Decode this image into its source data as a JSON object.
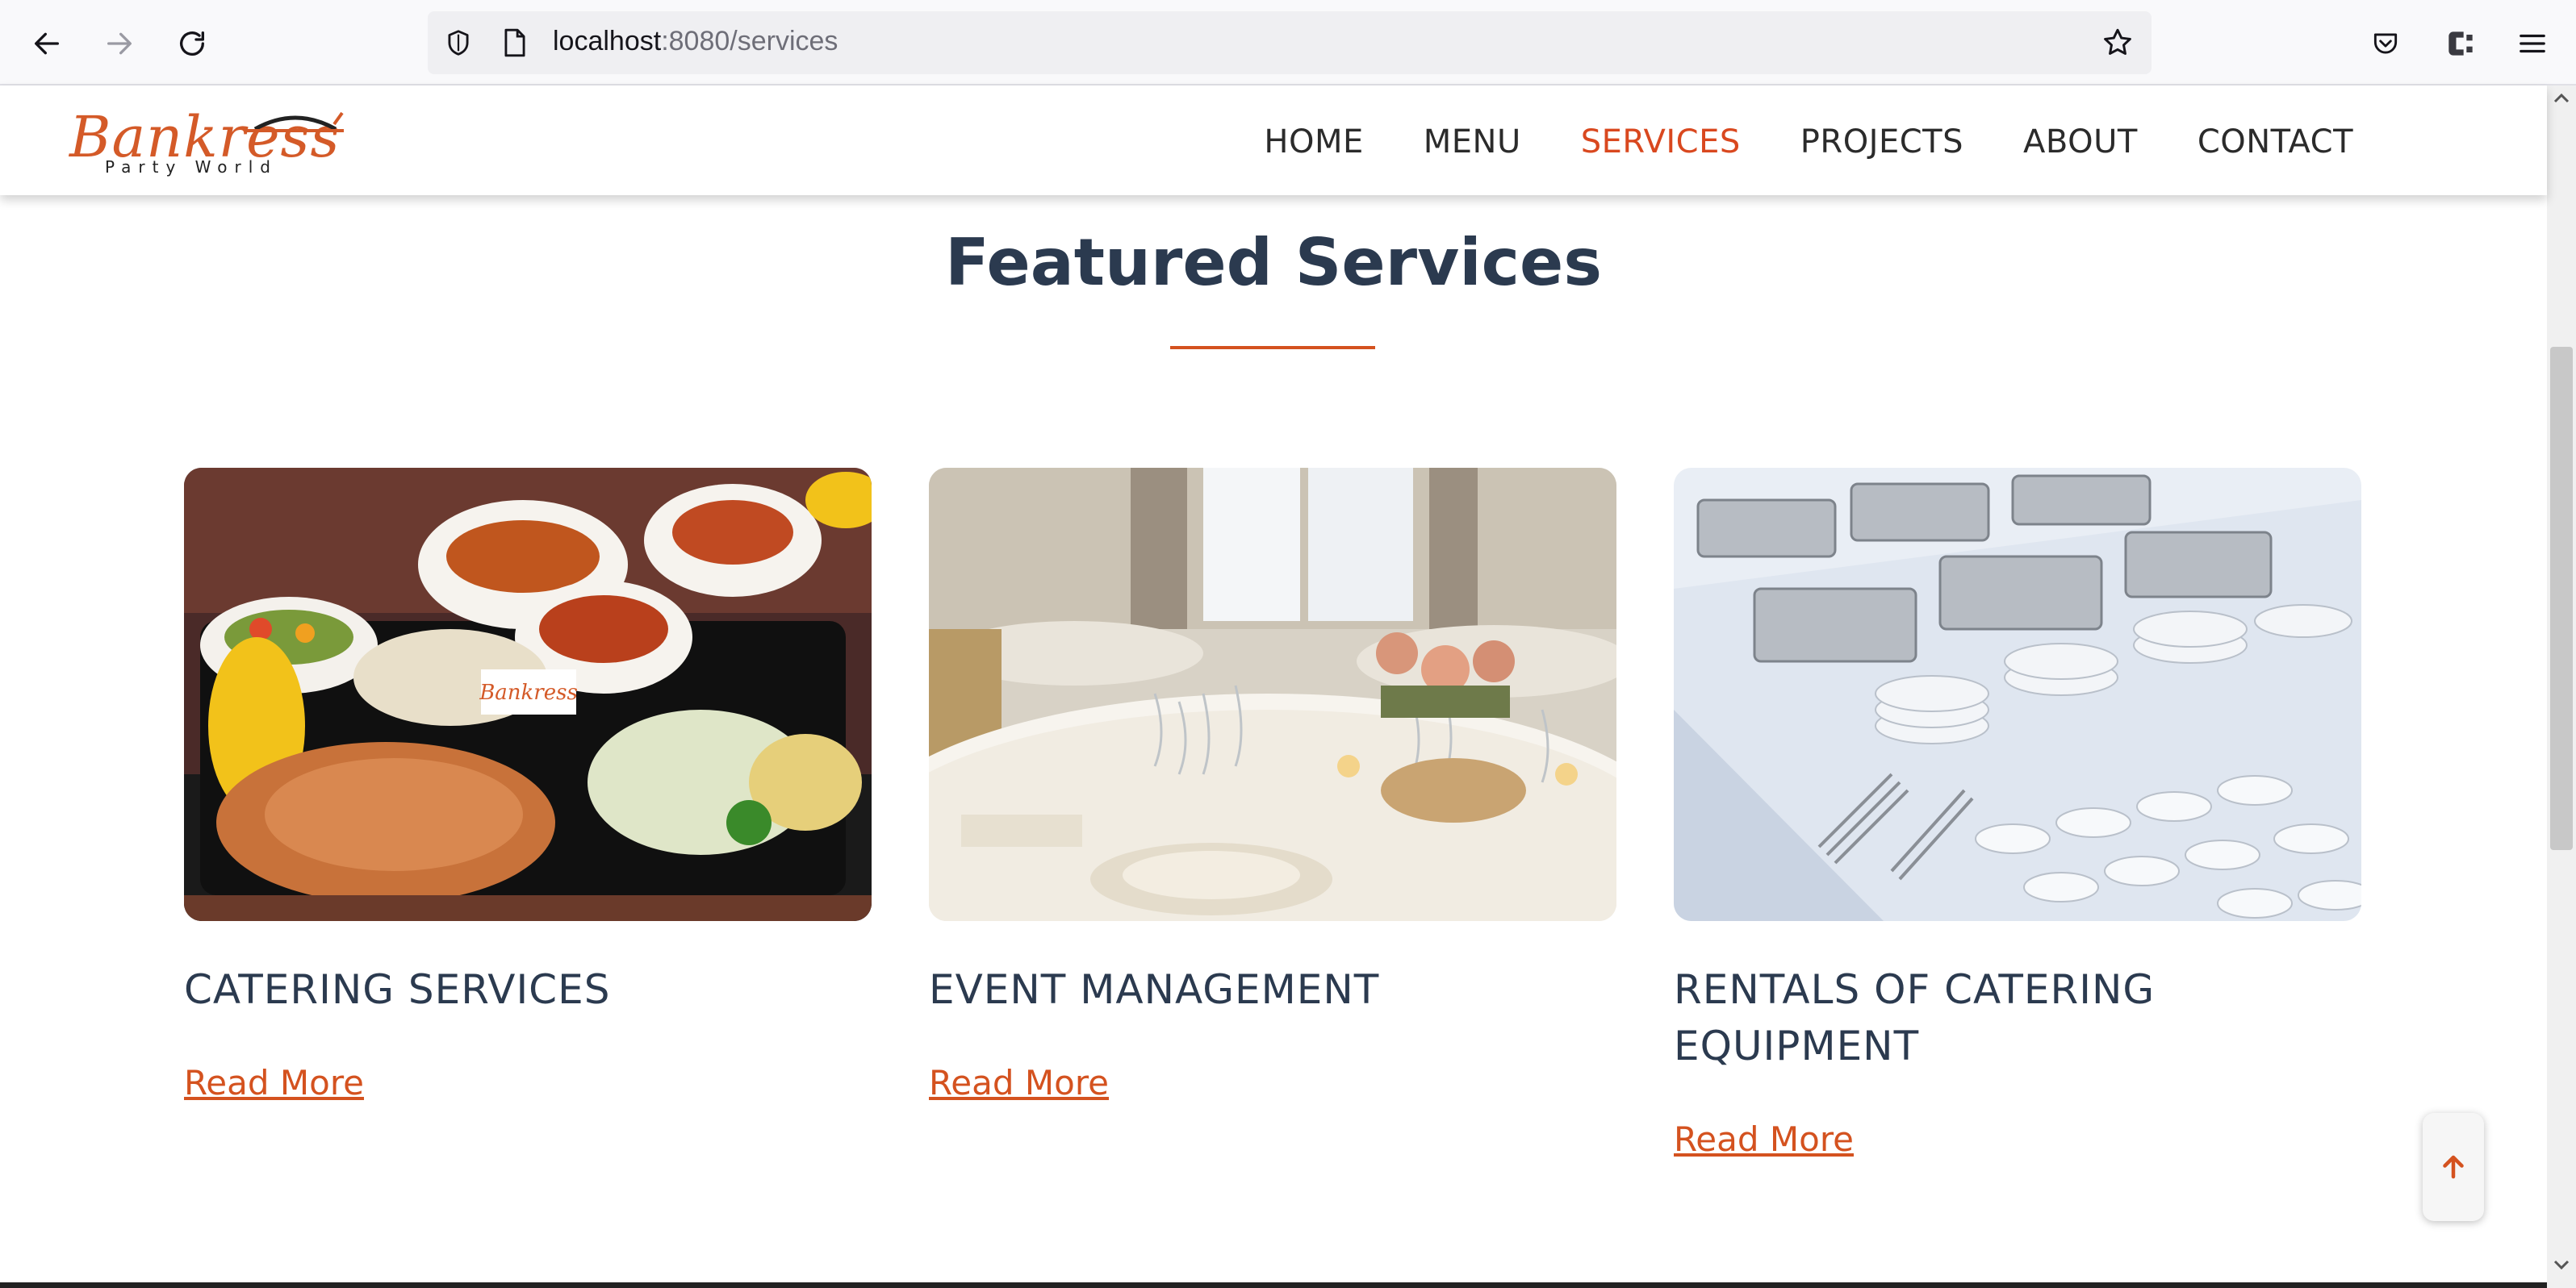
{
  "browser": {
    "url_host": "localhost",
    "url_path": ":8080/services"
  },
  "site": {
    "logo_text": "Bankress",
    "logo_subtext": "Party World",
    "nav": [
      {
        "label": "HOME",
        "active": false
      },
      {
        "label": "MENU",
        "active": false
      },
      {
        "label": "SERVICES",
        "active": true
      },
      {
        "label": "PROJECTS",
        "active": false
      },
      {
        "label": "ABOUT",
        "active": false
      },
      {
        "label": "CONTACT",
        "active": false
      }
    ]
  },
  "section": {
    "title": "Featured Services"
  },
  "cards": [
    {
      "title": "CATERING SERVICES",
      "link": "Read More",
      "image_logo": "Bankress"
    },
    {
      "title": "EVENT MANAGEMENT",
      "link": "Read More"
    },
    {
      "title": "RENTALS OF CATERING EQUIPMENT",
      "link": "Read More"
    }
  ],
  "colors": {
    "accent": "#d4521f",
    "heading": "#2b3a4f"
  },
  "icons": {
    "back": "arrow-left-icon",
    "forward": "arrow-right-icon",
    "reload": "reload-icon",
    "shield": "shield-icon",
    "page": "page-icon",
    "bookmark": "star-icon",
    "pocket": "pocket-icon",
    "extension": "extension-icon",
    "menu": "hamburger-icon",
    "back_to_top": "arrow-up-icon"
  }
}
